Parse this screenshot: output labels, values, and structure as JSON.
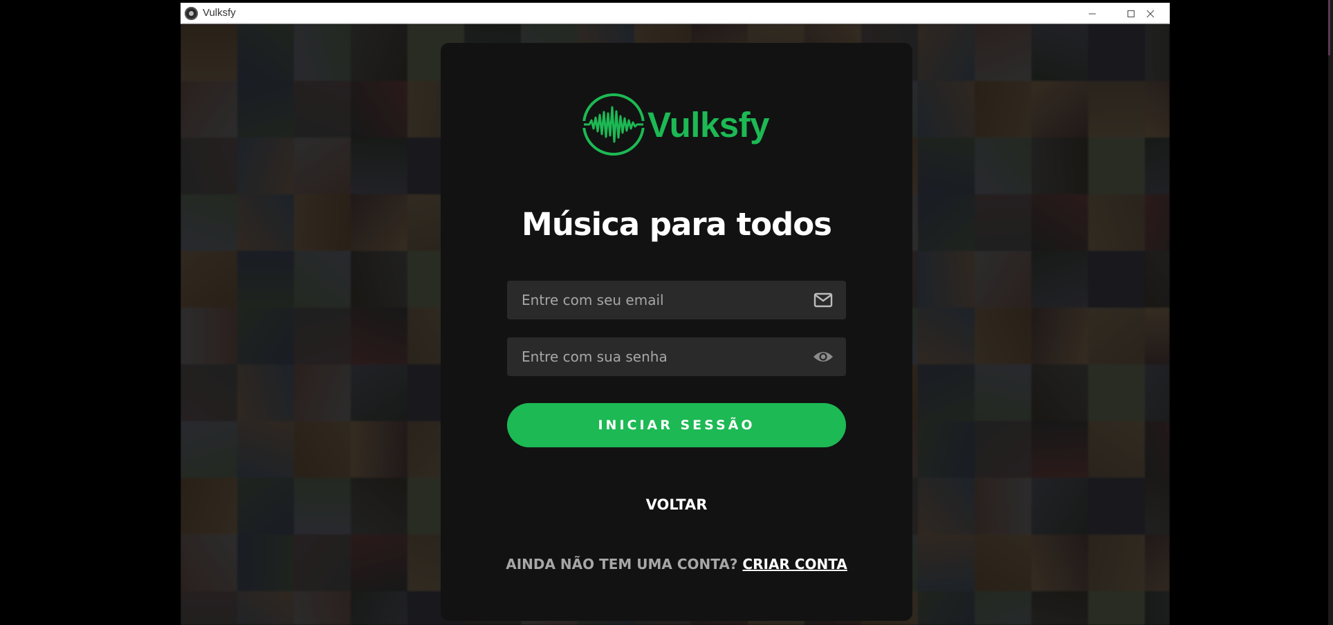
{
  "window": {
    "title": "Vulksfy",
    "controls": [
      "minimize-icon",
      "maximize-icon",
      "close-icon"
    ]
  },
  "background": {
    "tile_colors": [
      "#3a3a3a",
      "#4a4033",
      "#2d2a24",
      "#584a3a",
      "#343e4a",
      "#4d3a35",
      "#2a2a2a",
      "#4b5040",
      "#3a2d2d",
      "#505050",
      "#2e3340",
      "#4a3b2a",
      "#3d3d46",
      "#5a4d3d",
      "#2a2f2a",
      "#44393a",
      "#374036",
      "#4a4a55",
      "#60503c",
      "#2b2b35",
      "#4e2f2f",
      "#3f4a3b",
      "#56473a",
      "#383838"
    ]
  },
  "card": {
    "brand": {
      "name": "Vulksfy",
      "color": "#1db954"
    },
    "headline": "Música para todos",
    "email": {
      "placeholder": "Entre com seu email",
      "icon": "mail-icon"
    },
    "password": {
      "placeholder": "Entre com sua senha",
      "icon": "eye-icon"
    },
    "login_button": "INICIAR SESSÃO",
    "back_link": "VOLTAR",
    "signup_question": "AINDA NÃO TEM UMA CONTA?",
    "signup_link": "CRIAR CONTA"
  },
  "colors": {
    "accent": "#1db954",
    "card_bg": "#121212",
    "field_bg": "#2a2a2a"
  }
}
